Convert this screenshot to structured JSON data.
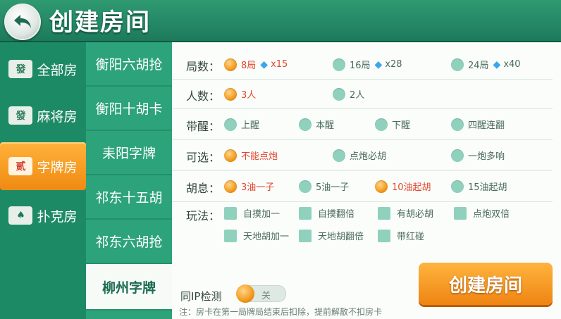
{
  "header": {
    "title": "创建房间"
  },
  "sidebar": {
    "items": [
      {
        "label": "全部房",
        "icon": "mahjong-tile-icon"
      },
      {
        "label": "麻将房",
        "icon": "mahjong-tile-icon"
      },
      {
        "label": "字牌房",
        "icon": "card-tiles-icon",
        "active": true
      },
      {
        "label": "扑克房",
        "icon": "playing-cards-icon"
      }
    ]
  },
  "games": {
    "items": [
      "衡阳六胡抢",
      "衡阳十胡卡",
      "耒阳字牌",
      "祁东十五胡",
      "祁东六胡抢",
      "柳州字牌"
    ],
    "active_index": 5
  },
  "options": {
    "rounds": {
      "label": "局数：",
      "choices": [
        {
          "text": "8局",
          "cost": "x15",
          "selected": true
        },
        {
          "text": "16局",
          "cost": "x28"
        },
        {
          "text": "24局",
          "cost": "x40"
        }
      ]
    },
    "players": {
      "label": "人数：",
      "choices": [
        {
          "text": "3人",
          "selected": true
        },
        {
          "text": "2人"
        }
      ]
    },
    "wake": {
      "label": "带醒：",
      "choices": [
        {
          "text": "上醒"
        },
        {
          "text": "本醒"
        },
        {
          "text": "下醒"
        },
        {
          "text": "四醒连翻"
        }
      ]
    },
    "optional": {
      "label": "可选：",
      "choices": [
        {
          "text": "不能点炮",
          "selected": true
        },
        {
          "text": "点炮必胡"
        },
        {
          "text": "一炮多响"
        }
      ]
    },
    "hu": {
      "label": "胡息：",
      "choices": [
        {
          "text": "3油一子",
          "selected": true
        },
        {
          "text": "5油一子"
        },
        {
          "text": "10油起胡",
          "selected": true
        },
        {
          "text": "15油起胡"
        }
      ]
    },
    "play": {
      "label": "玩法：",
      "choices": [
        "自摸加一",
        "自摸翻倍",
        "有胡必胡",
        "点炮双倍",
        "天地胡加一",
        "天地胡翻倍",
        "带红碰"
      ]
    }
  },
  "ip_check": {
    "label": "同IP检测",
    "state": "关"
  },
  "note": "注：房卡在第一局牌局结束后扣除，提前解散不扣房卡",
  "create_button": "创建房间",
  "colors": {
    "accent": "#f29a1c",
    "primary": "#2da37b",
    "selected_text": "#e0482c"
  }
}
